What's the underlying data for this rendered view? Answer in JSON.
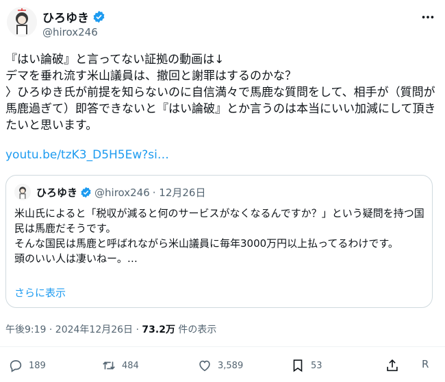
{
  "author": {
    "name": "ひろゆき",
    "handle": "@hirox246"
  },
  "tweet": {
    "text": "『はい論破』と言ってない証拠の動画は↓\nデマを垂れ流す米山議員は、撤回と謝罪はするのかな？\n〉ひろゆき氏が前提を知らないのに自信満々で馬鹿な質問をして、相手が（質問が馬鹿過ぎて）即答できないと『はい論破』とか言うのは本当にいい加減にして頂きたいと思います。",
    "link": "youtu.be/tzK3_D5H5Ew?si…"
  },
  "quote": {
    "name": "ひろゆき",
    "handle": "@hirox246",
    "date": "· 12月26日",
    "text": "米山氏によると「税収が減ると何のサービスがなくなるんですか？」という疑問を持つ国民は馬鹿だそうです。\nそんな国民は馬鹿と呼ばれながら米山議員に毎年3000万円以上払ってるわけです。\n頭のいい人は凄いねー。…",
    "more": "さらに表示"
  },
  "meta": {
    "time": "午後9:19 · 2024年12月26日 · ",
    "views": "73.2万",
    "views_suffix": " 件の表示"
  },
  "actions": {
    "replies": "189",
    "retweets": "484",
    "likes": "3,589",
    "bookmarks": "53",
    "extra": "R"
  },
  "colors": {
    "accent": "#1d9bf0",
    "muted": "#536471"
  }
}
